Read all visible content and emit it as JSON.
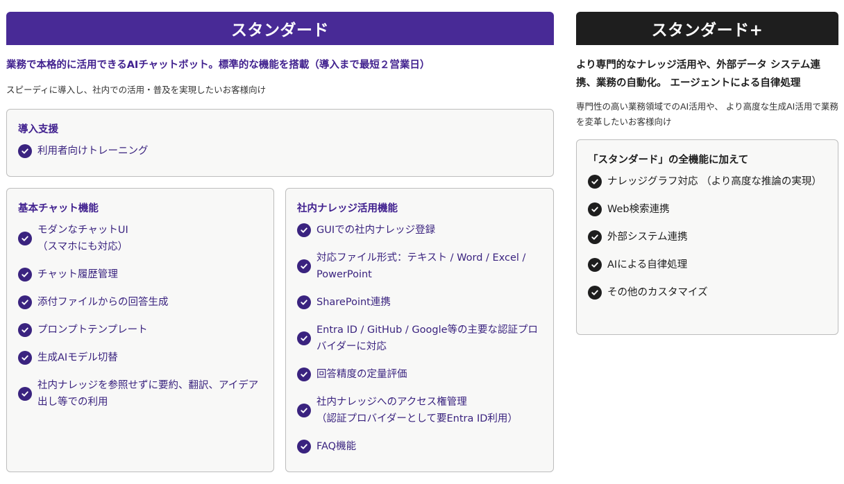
{
  "standard": {
    "title": "スタンダード",
    "tagline": "業務で本格的に活用できるAIチャットボット。標準的な機能を搭載（導入まで最短２営業日）",
    "target": "スピーディに導入し、社内での活用・普及を実現したいお客様向け",
    "onboarding": {
      "title": "導入支援",
      "items": [
        "利用者向けトレーニング"
      ]
    },
    "chat": {
      "title": "基本チャット機能",
      "items": [
        "モダンなチャットUI\n（スマホにも対応）",
        "チャット履歴管理",
        "添付ファイルからの回答生成",
        "プロンプトテンプレート",
        "生成AIモデル切替",
        "社内ナレッジを参照せずに要約、翻訳、アイデア出し等での利用"
      ]
    },
    "knowledge": {
      "title": "社内ナレッジ活用機能",
      "items": [
        "GUIでの社内ナレッジ登録",
        "対応ファイル形式：テキスト / Word / Excel / PowerPoint",
        "SharePoint連携",
        "Entra ID / GitHub / Google等の主要な認証プロバイダーに対応",
        "回答精度の定量評価",
        "社内ナレッジへのアクセス権管理\n（認証プロバイダーとして要Entra ID利用）",
        "FAQ機能"
      ]
    }
  },
  "standard_plus": {
    "title": "スタンダード+",
    "tagline": "より専門的なナレッジ活用や、外部データ システム連携、業務の自動化。 エージェントによる自律処理",
    "target": "専門性の高い業務領域でのAI活用や、 より高度な生成AI活用で業務を変革したいお客様向け",
    "features": {
      "title": "「スタンダード」の全機能に加えて",
      "items": [
        "ナレッジグラフ対応 （より高度な推論の実現）",
        "Web検索連携",
        "外部システム連携",
        "AIによる自律処理",
        "その他のカスタマイズ"
      ]
    }
  },
  "colors": {
    "standard_accent": "#482a96",
    "standard_text": "#41218f",
    "plus_accent": "#1e1e1e",
    "box_bg": "#f8f8f7"
  },
  "icons": {
    "check": "check-circle-icon"
  }
}
